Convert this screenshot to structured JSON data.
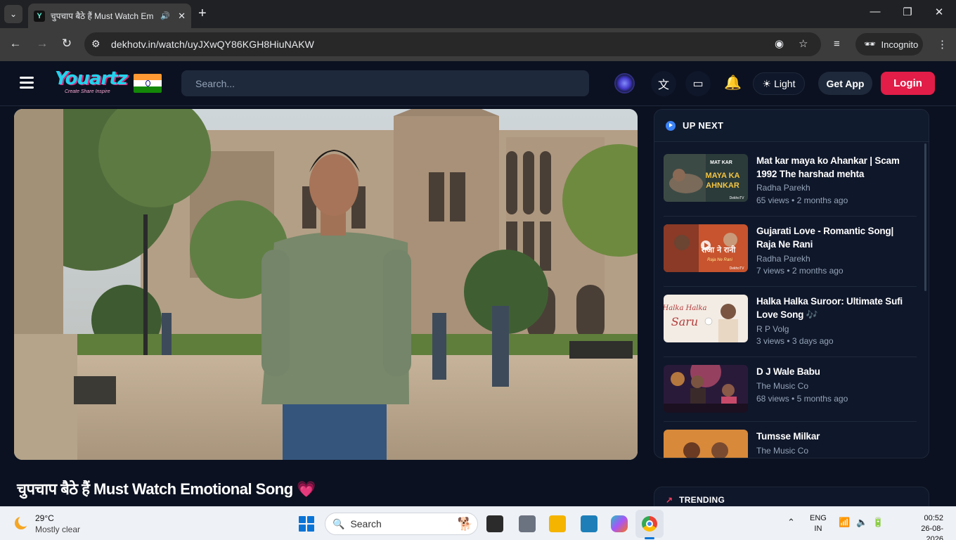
{
  "browser": {
    "tab_title": "चुपचाप बैठे हैं Must Watch Em",
    "url": "dekhotv.in/watch/uyJXwQY86KGH8HiuNAKW",
    "incognito_label": "Incognito"
  },
  "header": {
    "logo_text": "Youartz",
    "logo_tagline": "Create Share Inspire",
    "search_placeholder": "Search...",
    "theme_label": "Light",
    "get_app_label": "Get App",
    "login_label": "Login"
  },
  "video": {
    "title": "चुपचाप बैठे हैं Must Watch Emotional Song",
    "title_emoji": "💗"
  },
  "up_next": {
    "heading": "UP NEXT",
    "items": [
      {
        "title": "Mat kar maya ko Ahankar | Scam 1992 The harshad mehta",
        "channel": "Radha Parekh",
        "views": "65 views",
        "age": "2 months ago",
        "thumb_text": "MAYA KA AHNKAR",
        "thumb_top": "MAT KAR",
        "thumb_badge": "DekhoTV"
      },
      {
        "title": "Gujarati Love - Romantic Song| Raja Ne Rani",
        "channel": "Radha Parekh",
        "views": "7 views",
        "age": "2 months ago",
        "thumb_text": "राजा ने रानी",
        "thumb_top": "Raja Ne Rani",
        "thumb_badge": "DekhoTV"
      },
      {
        "title": "Halka Halka Suroor: Ultimate Sufi Love Song 🎶",
        "channel": "R P Volg",
        "views": "3 views",
        "age": "3 days ago",
        "thumb_text": "Halka Halka Saru",
        "thumb_top": "",
        "thumb_badge": ""
      },
      {
        "title": "D J Wale Babu",
        "channel": "The Music Co",
        "views": "68 views",
        "age": "5 months ago",
        "thumb_text": "",
        "thumb_top": "",
        "thumb_badge": ""
      },
      {
        "title": "Tumsse Milkar",
        "channel": "The Music Co",
        "views": "",
        "age": "",
        "thumb_text": "",
        "thumb_top": "",
        "thumb_badge": ""
      }
    ]
  },
  "trending": {
    "heading": "TRENDING"
  },
  "taskbar": {
    "temperature": "29°C",
    "weather": "Mostly clear",
    "search_label": "Search",
    "lang_line1": "ENG",
    "lang_line2": "IN",
    "time": "00:52",
    "date": "26-08-2026"
  }
}
